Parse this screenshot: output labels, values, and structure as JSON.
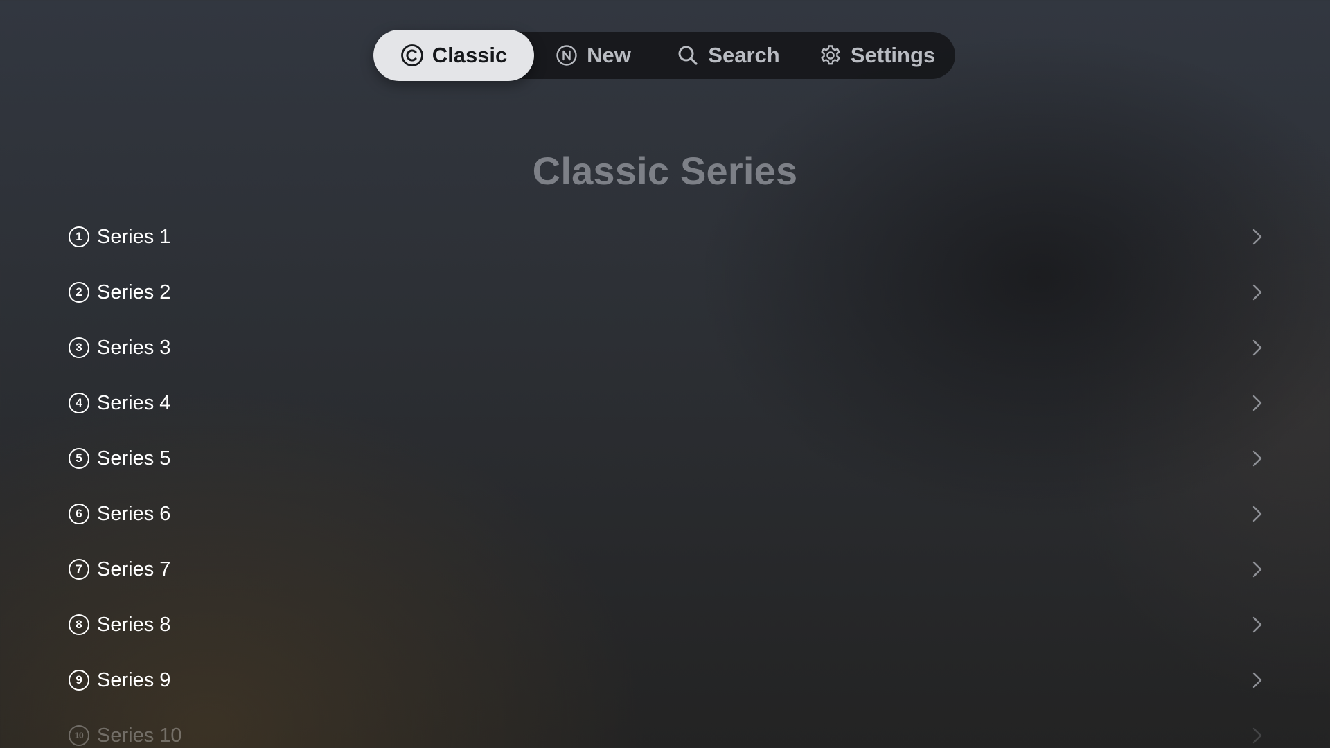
{
  "tabs": [
    {
      "label": "Classic",
      "icon": "c-circle-icon",
      "active": true
    },
    {
      "label": "New",
      "icon": "n-circle-icon",
      "active": false
    },
    {
      "label": "Search",
      "icon": "magnifier-icon",
      "active": false
    },
    {
      "label": "Settings",
      "icon": "gear-icon",
      "active": false
    }
  ],
  "title": "Classic Series",
  "series": [
    {
      "num": "1",
      "label": "Series 1"
    },
    {
      "num": "2",
      "label": "Series 2"
    },
    {
      "num": "3",
      "label": "Series 3"
    },
    {
      "num": "4",
      "label": "Series 4"
    },
    {
      "num": "5",
      "label": "Series 5"
    },
    {
      "num": "6",
      "label": "Series 6"
    },
    {
      "num": "7",
      "label": "Series 7"
    },
    {
      "num": "8",
      "label": "Series 8"
    },
    {
      "num": "9",
      "label": "Series 9"
    },
    {
      "num": "10",
      "label": "Series 10"
    }
  ],
  "colors": {
    "active_tab_bg": "#e4e5e8",
    "tabbar_bg": "#16171a",
    "title": "#7d8087",
    "text": "#ffffff"
  }
}
